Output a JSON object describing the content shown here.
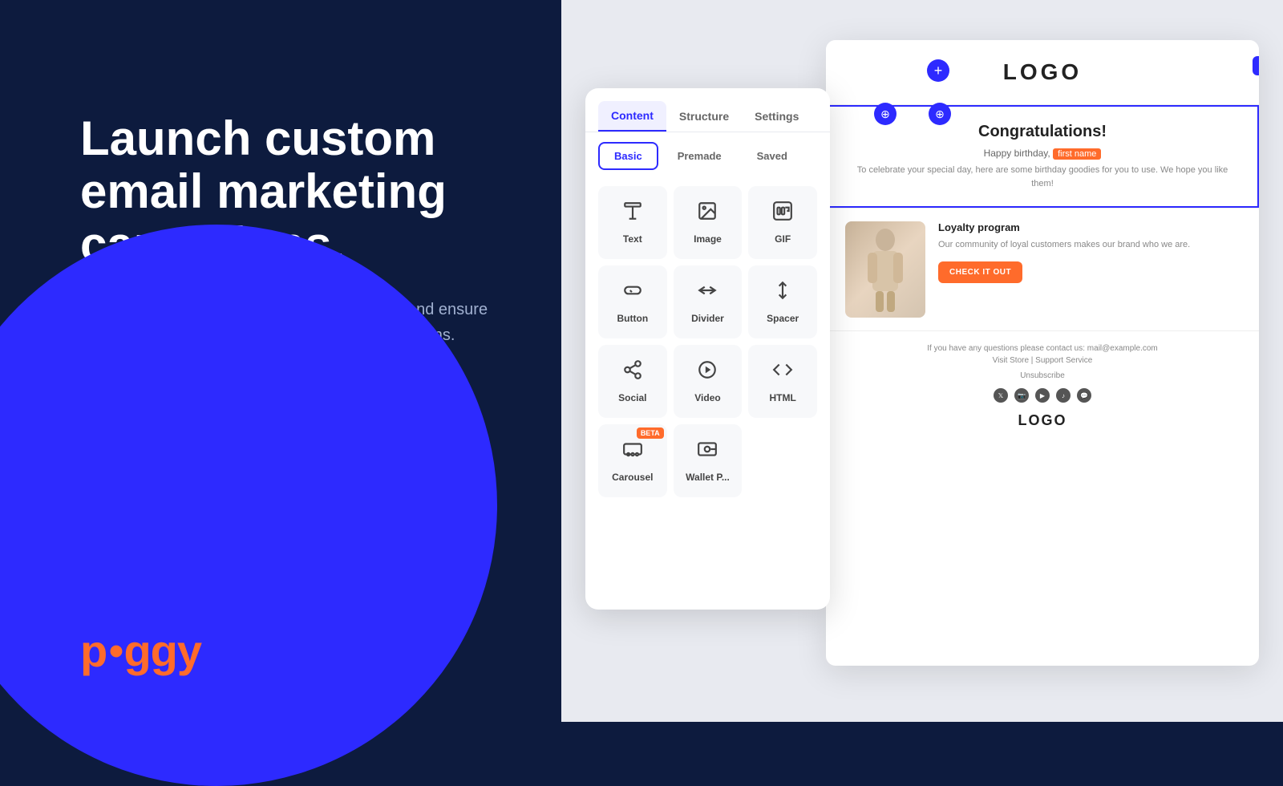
{
  "left": {
    "hero_title": "Launch custom email marketing campaigns.",
    "hero_subtitle": "Engage new members, nurture existing ones, and ensure you're always on the ball with automated campaigns.",
    "logo": "piggy"
  },
  "panel": {
    "tabs": [
      "Content",
      "Structure",
      "Settings"
    ],
    "active_tab": "Content",
    "subtabs": [
      "Basic",
      "Premade",
      "Saved"
    ],
    "active_subtab": "Basic",
    "items": [
      {
        "id": "text",
        "label": "Text",
        "icon": "text"
      },
      {
        "id": "image",
        "label": "Image",
        "icon": "image"
      },
      {
        "id": "gif",
        "label": "GIF",
        "icon": "gif"
      },
      {
        "id": "button",
        "label": "Button",
        "icon": "button"
      },
      {
        "id": "divider",
        "label": "Divider",
        "icon": "divider"
      },
      {
        "id": "spacer",
        "label": "Spacer",
        "icon": "spacer"
      },
      {
        "id": "social",
        "label": "Social",
        "icon": "social"
      },
      {
        "id": "video",
        "label": "Video",
        "icon": "video"
      },
      {
        "id": "html",
        "label": "HTML",
        "icon": "html"
      },
      {
        "id": "carousel",
        "label": "Carousel",
        "icon": "carousel",
        "beta": true
      },
      {
        "id": "walletpass",
        "label": "Wallet P...",
        "icon": "wallet"
      }
    ]
  },
  "email": {
    "logo": "LOGO",
    "congrats_title": "Congratulations!",
    "congrats_subtitle": "Happy birthday,",
    "highlight": "first name",
    "congrats_body": "To celebrate your special day, here are some birthday goodies for you to use. We hope you like them!",
    "product_title": "Loyalty program",
    "product_desc": "Our community of loyal customers makes our brand who we are.",
    "cta_button": "CHECK IT OUT",
    "footer_contact": "If you have any questions please contact us: mail@example.com",
    "footer_links": "Visit Store | Support Service",
    "footer_unsub": "Unsubscribe",
    "footer_logo": "LOGO",
    "structure_btn": "Structure"
  },
  "colors": {
    "primary": "#2d2aff",
    "accent": "#ff6b2b",
    "bg_dark": "#0d1b3e",
    "bg_light": "#e8eaf0"
  }
}
